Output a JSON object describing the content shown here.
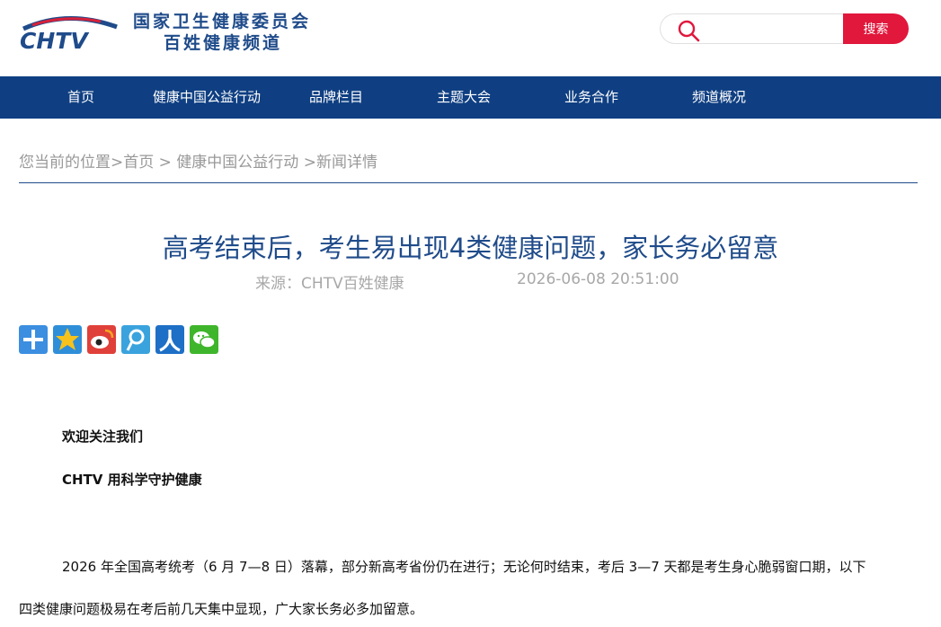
{
  "header": {
    "logo_text": "CHTV",
    "org_line1": "国家卫生健康委员会",
    "org_line2": "百姓健康频道",
    "search": {
      "placeholder": "",
      "button_label": "搜索"
    }
  },
  "nav": {
    "items": [
      {
        "label": "首页"
      },
      {
        "label": "健康中国公益行动"
      },
      {
        "label": "品牌栏目"
      },
      {
        "label": "主题大会"
      },
      {
        "label": "业务合作"
      },
      {
        "label": "频道概况"
      }
    ]
  },
  "breadcrumb": {
    "prefix": "您当前的位置>",
    "home": "首页",
    "sep1": " > ",
    "section": "健康中国公益行动",
    "sep2": " >",
    "current": "新闻详情"
  },
  "article": {
    "title": "高考结束后，考生易出现4类健康问题，家长务必留意",
    "source": "来源：CHTV百姓健康",
    "datetime": "2026-06-08 20:51:00",
    "welcome": "欢迎关注我们",
    "slogan": "CHTV 用科学守护健康",
    "para1_line1": "2026 年全国高考统考（6 月 7—8 日）落幕，部分新高考省份仍在进行；无论何时结束，考后 3—7 天都是考生身心脆弱窗口期，以下",
    "para1_line2": "四类健康问题极易在考后前几天集中显现，广大家长务必多加留意。"
  },
  "share": {
    "icons": [
      "share-more-icon",
      "qzone-icon",
      "weibo-icon",
      "tencent-weibo-icon",
      "renren-icon",
      "wechat-icon"
    ]
  },
  "colors": {
    "brand_blue": "#0f3f82",
    "title_blue": "#1f4b8a",
    "search_red": "#e1173c",
    "logo_red": "#d8213a"
  }
}
